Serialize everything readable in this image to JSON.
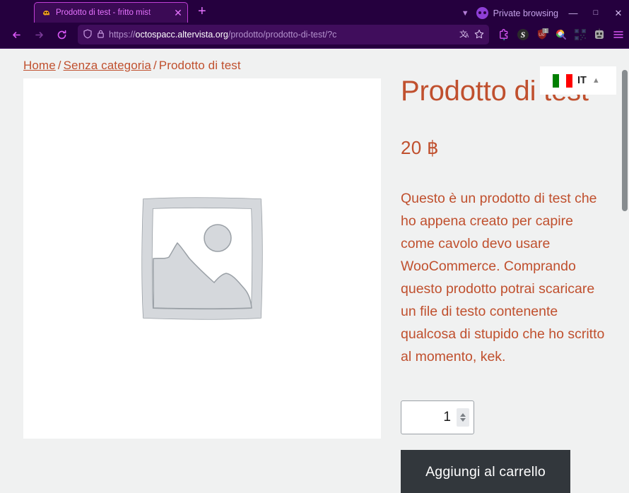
{
  "browser": {
    "tab": {
      "title": "Prodotto di test - fritto mist",
      "favicon_icon": "octopus-favicon",
      "close_icon": "close-icon"
    },
    "new_tab_label": "+",
    "tab_list_chevron_icon": "chevron-down-icon",
    "private_browsing_label": "Private browsing",
    "private_browsing_icon": "mask-icon",
    "window_controls": {
      "minimize": "—",
      "maximize": "□",
      "close": "✕"
    },
    "nav": {
      "back_icon": "arrow-left-icon",
      "forward_icon": "arrow-right-icon",
      "reload_icon": "reload-icon"
    },
    "url": {
      "shield_icon": "shield-icon",
      "lock_icon": "lock-icon",
      "scheme": "https://",
      "domain": "octospacc.altervista.org",
      "path": "/prodotto/prodotto-di-test/?c",
      "translate_icon": "translate-icon",
      "bookmark_icon": "star-icon"
    },
    "extensions": [
      {
        "name": "extensions-puzzle-icon",
        "label": ""
      },
      {
        "name": "stylus-extension-icon",
        "label": "S"
      },
      {
        "name": "ublock-origin-icon",
        "label": "Uo",
        "badge": "1"
      },
      {
        "name": "search-lens-icon",
        "label": "Q"
      },
      {
        "name": "qr-code-icon",
        "label": ""
      },
      {
        "name": "account-avatar-icon",
        "label": ""
      },
      {
        "name": "app-menu-icon",
        "label": ""
      }
    ]
  },
  "page": {
    "breadcrumb": {
      "home": "Home",
      "category": "Senza categoria",
      "current": "Prodotto di test",
      "separator": "/"
    },
    "gallery": {
      "placeholder_alt": "Segnaposto",
      "placeholder_icon": "image-placeholder-icon"
    },
    "product": {
      "title": "Prodotto di test",
      "price": "20 ฿",
      "description": "Questo è un prodotto di test che ho appena creato per capire come cavolo devo usare WooCommerce. Comprando questo prodotto potrai scaricare un file di testo contenente qualcosa di stupido che ho scritto al momento, kek.",
      "quantity_value": "1",
      "quantity_placeholder": "1",
      "add_to_cart_label": "Aggiungi al carrello"
    },
    "language_widget": {
      "code": "IT",
      "flag_icon": "italian-flag-icon",
      "chevron_icon": "chevron-up-icon"
    }
  },
  "colors": {
    "chrome_bg": "#25003e",
    "accent_magenta": "#d957f5",
    "brand_red": "#c0502e",
    "button_dark": "#32373c",
    "page_bg": "#f0f1f1"
  }
}
